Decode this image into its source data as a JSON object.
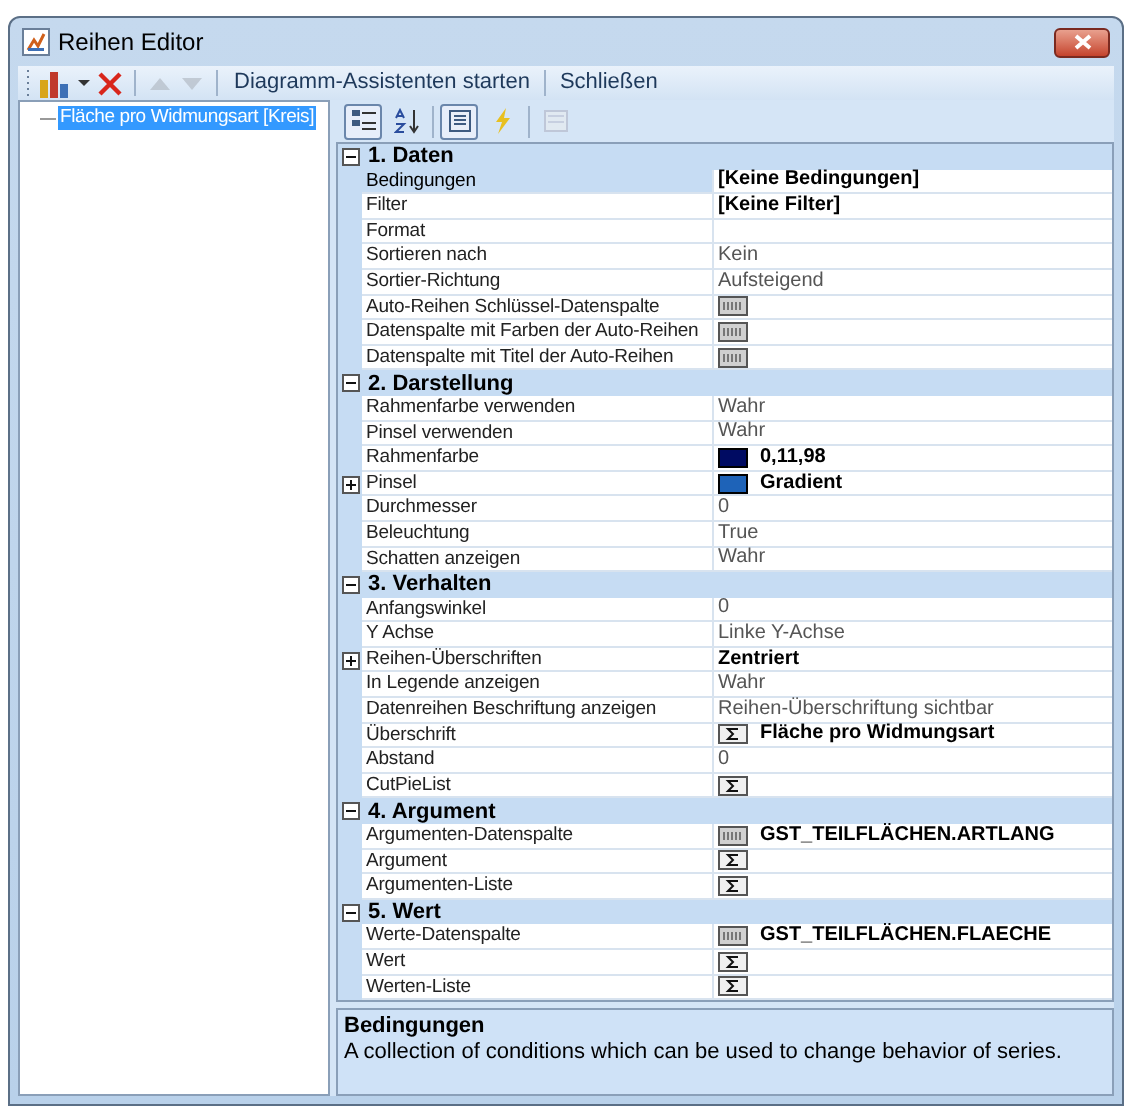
{
  "window": {
    "title": "Reihen Editor"
  },
  "toolbar": {
    "buttons": [
      {
        "kind": "chart",
        "disabled": false
      },
      {
        "kind": "caret",
        "disabled": false
      },
      {
        "kind": "delete",
        "disabled": false
      },
      {
        "kind": "up",
        "disabled": true
      },
      {
        "kind": "down",
        "disabled": true
      }
    ],
    "text_buttons": [
      "Diagramm-Assistenten starten",
      "Schließen"
    ]
  },
  "tree": {
    "items": [
      {
        "label": "Fläche pro Widmungsart [Kreis]",
        "selected": true
      }
    ]
  },
  "grid_toolbar": [
    {
      "kind": "categorized",
      "pressed": true,
      "disabled": false
    },
    {
      "kind": "alphabetical",
      "pressed": false,
      "disabled": false
    },
    {
      "kind": "properties",
      "pressed": true,
      "disabled": false
    },
    {
      "kind": "events",
      "pressed": false,
      "disabled": false
    },
    {
      "kind": "pages",
      "pressed": false,
      "disabled": true
    }
  ],
  "categories": [
    {
      "title": "1. Daten",
      "expanded": true,
      "properties": [
        {
          "name": "Bedingungen",
          "value": "[Keine Bedingungen]",
          "bold": true,
          "selected": true
        },
        {
          "name": "Filter",
          "value": "[Keine Filter]",
          "bold": true,
          "selected": false
        },
        {
          "name": "Format",
          "kind": "text",
          "selected": false
        },
        {
          "name": "Sortieren nach",
          "value": "Kein",
          "bold": false,
          "selected": false
        },
        {
          "name": "Sortier-Richtung",
          "value": "Aufsteigend",
          "bold": false,
          "selected": false
        },
        {
          "name": "Auto-Reihen Schlüssel-Datenspalte",
          "kind": "column",
          "selected": false
        },
        {
          "name": "Datenspalte mit Farben der Auto-Reihen",
          "kind": "column",
          "selected": false
        },
        {
          "name": "Datenspalte mit Titel der Auto-Reihen",
          "kind": "column",
          "selected": false
        }
      ]
    },
    {
      "title": "2. Darstellung",
      "expanded": true,
      "properties": [
        {
          "name": "Rahmenfarbe verwenden",
          "value": "Wahr",
          "bold": false,
          "selected": false
        },
        {
          "name": "Pinsel verwenden",
          "value": "Wahr",
          "bold": false,
          "selected": false
        },
        {
          "name": "Rahmenfarbe",
          "kind": "color",
          "color": "#000b62",
          "value": "0,11,98",
          "bold": true,
          "selected": false
        },
        {
          "name": "Pinsel",
          "expanded": false,
          "kind": "color",
          "color": "#1e63b8",
          "value": "Gradient",
          "bold": true,
          "selected": false
        },
        {
          "name": "Durchmesser",
          "value": "0",
          "bold": false,
          "selected": false
        },
        {
          "name": "Beleuchtung",
          "value": "True",
          "bold": false,
          "selected": false
        },
        {
          "name": "Schatten anzeigen",
          "value": "Wahr",
          "bold": false,
          "selected": false
        }
      ]
    },
    {
      "title": "3. Verhalten",
      "expanded": true,
      "properties": [
        {
          "name": "Anfangswinkel",
          "value": "0",
          "bold": false,
          "selected": false
        },
        {
          "name": "Y Achse",
          "value": "Linke Y-Achse",
          "bold": false,
          "selected": false
        },
        {
          "name": "Reihen-Überschriften",
          "expanded": false,
          "value": "Zentriert",
          "bold": true,
          "selected": false
        },
        {
          "name": "In Legende anzeigen",
          "value": "Wahr",
          "bold": false,
          "selected": false
        },
        {
          "name": "Datenreihen Beschriftung anzeigen",
          "value": "Reihen-Überschriftung sichtbar",
          "bold": false,
          "selected": false
        },
        {
          "name": "Überschrift",
          "kind": "sigma",
          "value": "Fläche pro Widmungsart",
          "bold": true,
          "selected": false
        },
        {
          "name": "Abstand",
          "value": "0",
          "bold": false,
          "selected": false
        },
        {
          "name": "CutPieList",
          "kind": "sigma",
          "selected": false
        }
      ]
    },
    {
      "title": "4. Argument",
      "expanded": true,
      "properties": [
        {
          "name": "Argumenten-Datenspalte",
          "kind": "column",
          "value": "GST_TEILFLÄCHEN.ARTLANG",
          "bold": true,
          "selected": false
        },
        {
          "name": "Argument",
          "kind": "sigma",
          "selected": false
        },
        {
          "name": "Argumenten-Liste",
          "kind": "sigma",
          "selected": false
        }
      ]
    },
    {
      "title": "5. Wert",
      "expanded": true,
      "properties": [
        {
          "name": "Werte-Datenspalte",
          "kind": "column",
          "value": "GST_TEILFLÄCHEN.FLAECHE",
          "bold": true,
          "selected": false
        },
        {
          "name": "Wert",
          "kind": "sigma",
          "selected": false
        },
        {
          "name": "Werten-Liste",
          "kind": "sigma",
          "selected": false
        }
      ]
    }
  ],
  "help": {
    "title": "Bedingungen",
    "text": "A collection of conditions which can be used to change behavior of series."
  }
}
